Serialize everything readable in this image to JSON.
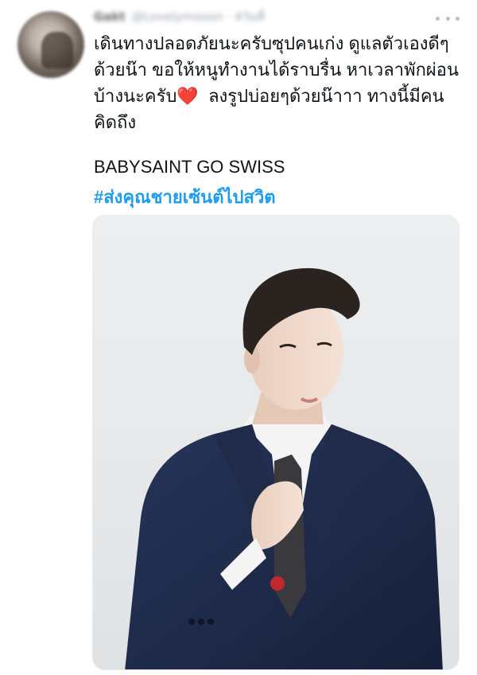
{
  "tweet": {
    "author_name": "Gakt",
    "author_handle": "@Lovelymooon · 4วันที่",
    "body_lines": [
      "เดินทางปลอดภัยนะครับซุปคนเก่ง ดูแลตัวเองดีๆ",
      "ด้วยน๊า ขอให้หนูทำงานได้ราบรื่น หาเวลาพักผ่อน",
      "บ้างนะครับ",
      "ลงรูปบ่อยๆด้วยน๊าาา ทางนี้มีคน",
      "คิดถึง"
    ],
    "heart_emoji": "❤️",
    "title": "BABYSAINT GO SWISS",
    "hashtag": "#ส่งคุณชายเซ้นต์ไปสวิต"
  },
  "icons": {
    "more": "more-horizontal-icon"
  },
  "colors": {
    "text": "#0f1419",
    "link": "#1d9bf0",
    "heart": "#e0245e",
    "suit": "#1e2a44",
    "background": "#ffffff"
  }
}
